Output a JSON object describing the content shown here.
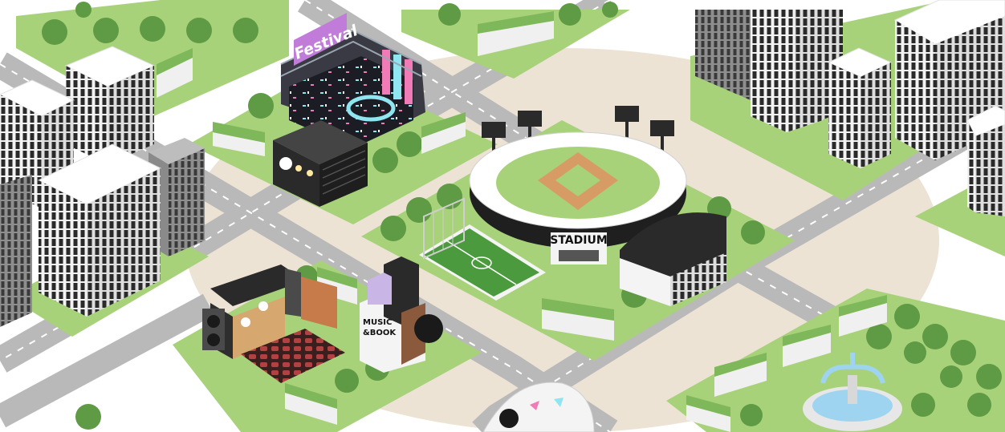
{
  "scene": {
    "festival_sign": "Festival",
    "stadium_sign": "STADIUM",
    "music_sign_line1": "MUSIC",
    "music_sign_line2": "&BOOK"
  },
  "colors": {
    "road": "#b9b9b9",
    "road_marking": "#ffffff",
    "plaza": "#ece3d5",
    "grass": "#a8d27a",
    "grass_dark": "#7fb85a",
    "tree": "#5f9a44",
    "building_light": "#f4f4f4",
    "building_gray": "#9a9a9a",
    "window": "#2a2a2a",
    "stage_pink": "#f07bb7",
    "stage_cyan": "#8fe6f0",
    "fountain_water": "#9fd4f0"
  }
}
